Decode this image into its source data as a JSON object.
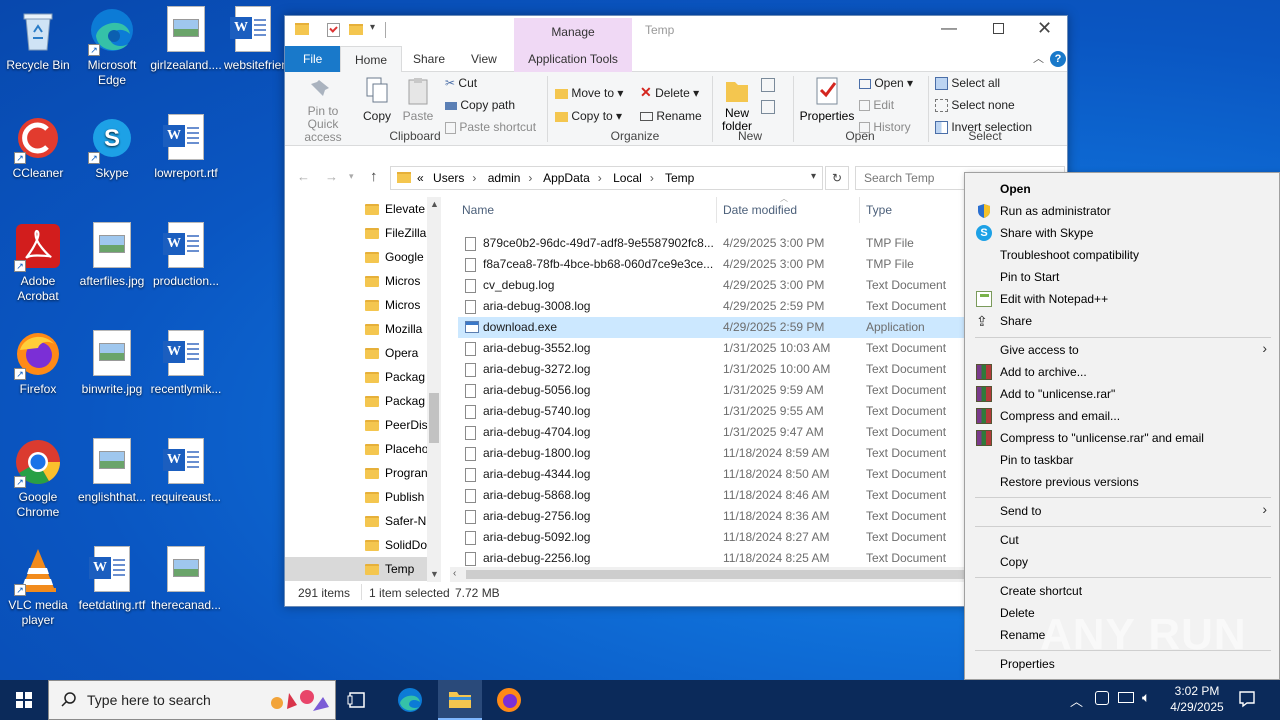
{
  "desktop": {
    "icons": [
      {
        "label": "Recycle Bin"
      },
      {
        "label": "Microsoft Edge"
      },
      {
        "label": "girlzealand...."
      },
      {
        "label": "websitefriend.rtf"
      },
      {
        "label": "CCleaner"
      },
      {
        "label": "Skype"
      },
      {
        "label": "lowreport.rtf"
      },
      {
        "label": "Adobe Acrobat"
      },
      {
        "label": "afterfiles.jpg"
      },
      {
        "label": "production..."
      },
      {
        "label": "Firefox"
      },
      {
        "label": "binwrite.jpg"
      },
      {
        "label": "recentlymik..."
      },
      {
        "label": "Google Chrome"
      },
      {
        "label": "englishthat..."
      },
      {
        "label": "requireaust..."
      },
      {
        "label": "VLC media player"
      },
      {
        "label": "feetdating.rtf"
      },
      {
        "label": "therecanad..."
      }
    ]
  },
  "explorer": {
    "title": "Temp",
    "context_tab": "Manage",
    "tabs": {
      "file": "File",
      "home": "Home",
      "share": "Share",
      "view": "View",
      "app_tools": "Application Tools"
    },
    "ribbon": {
      "pin": "Pin to Quick access",
      "copy": "Copy",
      "paste": "Paste",
      "cut": "Cut",
      "copy_path": "Copy path",
      "paste_shortcut": "Paste shortcut",
      "move_to": "Move to",
      "copy_to": "Copy to",
      "delete": "Delete",
      "rename": "Rename",
      "new_folder": "New folder",
      "properties": "Properties",
      "open": "Open",
      "edit": "Edit",
      "history": "History",
      "select_all": "Select all",
      "select_none": "Select none",
      "invert_selection": "Invert selection",
      "groups": {
        "clipboard": "Clipboard",
        "organize": "Organize",
        "new": "New",
        "open": "Open",
        "select": "Select"
      }
    },
    "address": {
      "prefix": "«",
      "crumbs": [
        "Users",
        "admin",
        "AppData",
        "Local",
        "Temp"
      ]
    },
    "search_placeholder": "Search Temp",
    "nav_items": [
      "Elevate",
      "FileZilla",
      "Google",
      "Micros",
      "Micros",
      "Mozilla",
      "Opera",
      "Packag",
      "Packag",
      "PeerDis",
      "Placeho",
      "Progran",
      "Publish",
      "Safer-N",
      "SolidDo",
      "Temp"
    ],
    "columns": {
      "name": "Name",
      "date": "Date modified",
      "type": "Type"
    },
    "files": [
      {
        "name": "879ce0b2-96dc-49d7-adf8-9e5587902fc8....",
        "date": "4/29/2025 3:00 PM",
        "type": "TMP File"
      },
      {
        "name": "f8a7cea8-78fb-4bce-bb68-060d7ce9e3ce....",
        "date": "4/29/2025 3:00 PM",
        "type": "TMP File"
      },
      {
        "name": "cv_debug.log",
        "date": "4/29/2025 3:00 PM",
        "type": "Text Document"
      },
      {
        "name": "aria-debug-3008.log",
        "date": "4/29/2025 2:59 PM",
        "type": "Text Document"
      },
      {
        "name": "download.exe",
        "date": "4/29/2025 2:59 PM",
        "type": "Application"
      },
      {
        "name": "aria-debug-3552.log",
        "date": "1/31/2025 10:03 AM",
        "type": "Text Document"
      },
      {
        "name": "aria-debug-3272.log",
        "date": "1/31/2025 10:00 AM",
        "type": "Text Document"
      },
      {
        "name": "aria-debug-5056.log",
        "date": "1/31/2025 9:59 AM",
        "type": "Text Document"
      },
      {
        "name": "aria-debug-5740.log",
        "date": "1/31/2025 9:55 AM",
        "type": "Text Document"
      },
      {
        "name": "aria-debug-4704.log",
        "date": "1/31/2025 9:47 AM",
        "type": "Text Document"
      },
      {
        "name": "aria-debug-1800.log",
        "date": "11/18/2024 8:59 AM",
        "type": "Text Document"
      },
      {
        "name": "aria-debug-4344.log",
        "date": "11/18/2024 8:50 AM",
        "type": "Text Document"
      },
      {
        "name": "aria-debug-5868.log",
        "date": "11/18/2024 8:46 AM",
        "type": "Text Document"
      },
      {
        "name": "aria-debug-2756.log",
        "date": "11/18/2024 8:36 AM",
        "type": "Text Document"
      },
      {
        "name": "aria-debug-5092.log",
        "date": "11/18/2024 8:27 AM",
        "type": "Text Document"
      },
      {
        "name": "aria-debug-2256.log",
        "date": "11/18/2024 8:25 AM",
        "type": "Text Document"
      }
    ],
    "status": {
      "count": "291 items",
      "selected": "1 item selected",
      "size": "7.72 MB"
    }
  },
  "context_menu": {
    "items": [
      "Open",
      "Run as administrator",
      "Share with Skype",
      "Troubleshoot compatibility",
      "Pin to Start",
      "Edit with Notepad++",
      "Share",
      "Give access to",
      "Add to archive...",
      "Add to \"unlicense.rar\"",
      "Compress and email...",
      "Compress to \"unlicense.rar\" and email",
      "Pin to taskbar",
      "Restore previous versions",
      "Send to",
      "Cut",
      "Copy",
      "Create shortcut",
      "Delete",
      "Rename",
      "Properties"
    ]
  },
  "taskbar": {
    "search_placeholder": "Type here to search",
    "time": "3:02 PM",
    "date": "4/29/2025"
  },
  "watermark": "ANY RUN",
  "colors": {
    "desktop": "#0f6fd8",
    "taskbar": "#0b2a5a",
    "selection": "#cce8ff",
    "file_tab": "#1979ca",
    "manage_tab": "#f0d9f5"
  }
}
